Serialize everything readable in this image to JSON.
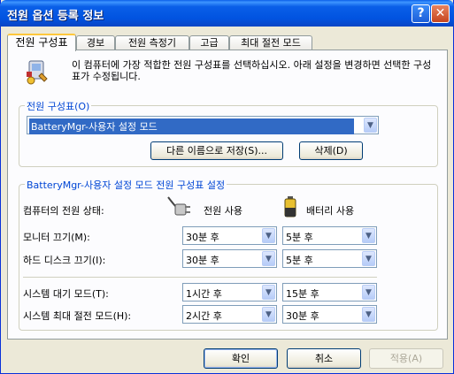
{
  "window": {
    "title": "전원 옵션 등록 정보"
  },
  "title_buttons": {
    "help": "?",
    "close": "✕"
  },
  "tabs": [
    "전원 구성표",
    "경보",
    "전원 측정기",
    "고급",
    "최대 절전 모드"
  ],
  "intro_text": "이 컴퓨터에 가장 적합한 전원 구성표를 선택하십시오. 아래 설정을 변경하면 선택한 구성표가 수정됩니다.",
  "scheme_group": {
    "label": "전원 구성표(O)",
    "selected": "BatteryMgr-사용자 설정 모드",
    "save_as_label": "다른 이름으로 저장(S)...",
    "delete_label": "삭제(D)"
  },
  "settings_group": {
    "label": "BatteryMgr-사용자 설정 모드 전원 구성표 설정",
    "state_label": "컴퓨터의 전원 상태:",
    "ac_label": "전원 사용",
    "battery_label": "배터리 사용",
    "rows": [
      {
        "label": "모니터 끄기(M):",
        "ac": "30분 후",
        "battery": "5분 후"
      },
      {
        "label": "하드 디스크 끄기(I):",
        "ac": "30분 후",
        "battery": "5분 후"
      },
      {
        "label": "시스템 대기 모드(T):",
        "ac": "1시간 후",
        "battery": "15분 후"
      },
      {
        "label": "시스템 최대 절전 모드(H):",
        "ac": "2시간 후",
        "battery": "30분 후"
      }
    ]
  },
  "footer": {
    "ok": "확인",
    "cancel": "취소",
    "apply": "적용(A)"
  },
  "icons": {
    "scheme": "power-scheme-icon",
    "ac": "plug-icon",
    "battery": "battery-icon",
    "dropdown": "chevron-down-icon"
  }
}
